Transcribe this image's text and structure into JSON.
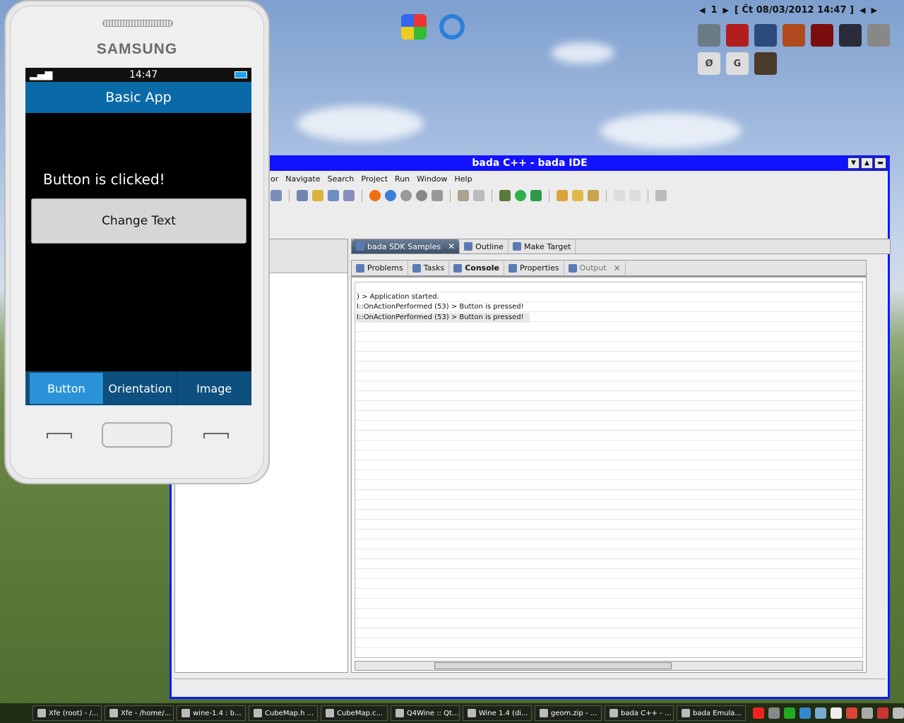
{
  "topbar": {
    "workspace": "1",
    "datetime": "[ Čt 08/03/2012 14:47 ]"
  },
  "tray_icons": [
    {
      "name": "dota-icon",
      "color": "#6b7b86",
      "label": ""
    },
    {
      "name": "mafia-icon",
      "color": "#b21e1e",
      "label": ""
    },
    {
      "name": "jet-icon",
      "color": "#2d4a7c",
      "label": ""
    },
    {
      "name": "game-icon",
      "color": "#b04a1e",
      "label": ""
    },
    {
      "name": "red-orb-icon",
      "color": "#7a0e0e",
      "label": ""
    },
    {
      "name": "space-icon",
      "color": "#2b2b3b",
      "label": ""
    },
    {
      "name": "checker-icon",
      "color": "#888888",
      "label": ""
    },
    {
      "name": "oblivion-icon",
      "color": "#ddd",
      "label": "Ø"
    },
    {
      "name": "g-icon",
      "color": "#ddd",
      "label": "G"
    },
    {
      "name": "soldier-icon",
      "color": "#4a3a2a",
      "label": ""
    }
  ],
  "ide": {
    "title": "bada C++ - bada IDE",
    "menu": [
      "or",
      "Navigate",
      "Search",
      "Project",
      "Run",
      "Window",
      "Help"
    ],
    "editor_tabs": [
      {
        "label": "bada SDK Samples",
        "active": true
      },
      {
        "label": "Outline",
        "active": false
      },
      {
        "label": "Make Target",
        "active": false
      }
    ],
    "console_tabs": [
      {
        "label": "Problems"
      },
      {
        "label": "Tasks"
      },
      {
        "label": "Console"
      },
      {
        "label": "Properties"
      },
      {
        "label": "Output"
      }
    ],
    "console_lines": [
      ") > Application started.",
      "I::OnActionPerformed (53) > Button is pressed!",
      "I::OnActionPerformed (53) > Button is pressed!"
    ]
  },
  "phone": {
    "brand": "SAMSUNG",
    "time": "14:47",
    "app_title": "Basic App",
    "message": "Button is clicked!",
    "button_label": "Change Text",
    "tabs": [
      "Button",
      "Orientation",
      "Image"
    ]
  },
  "taskbar": {
    "tasks": [
      "Xfe (root) - /...",
      "Xfe - /home/...",
      "wine-1.4 : b...",
      "CubeMap.h ...",
      "CubeMap.c...",
      "Q4Wine :: Qt...",
      "Wine 1.4 (di...",
      "geom.zip - ...",
      "bada C++ - ...",
      "bada Emula..."
    ]
  }
}
